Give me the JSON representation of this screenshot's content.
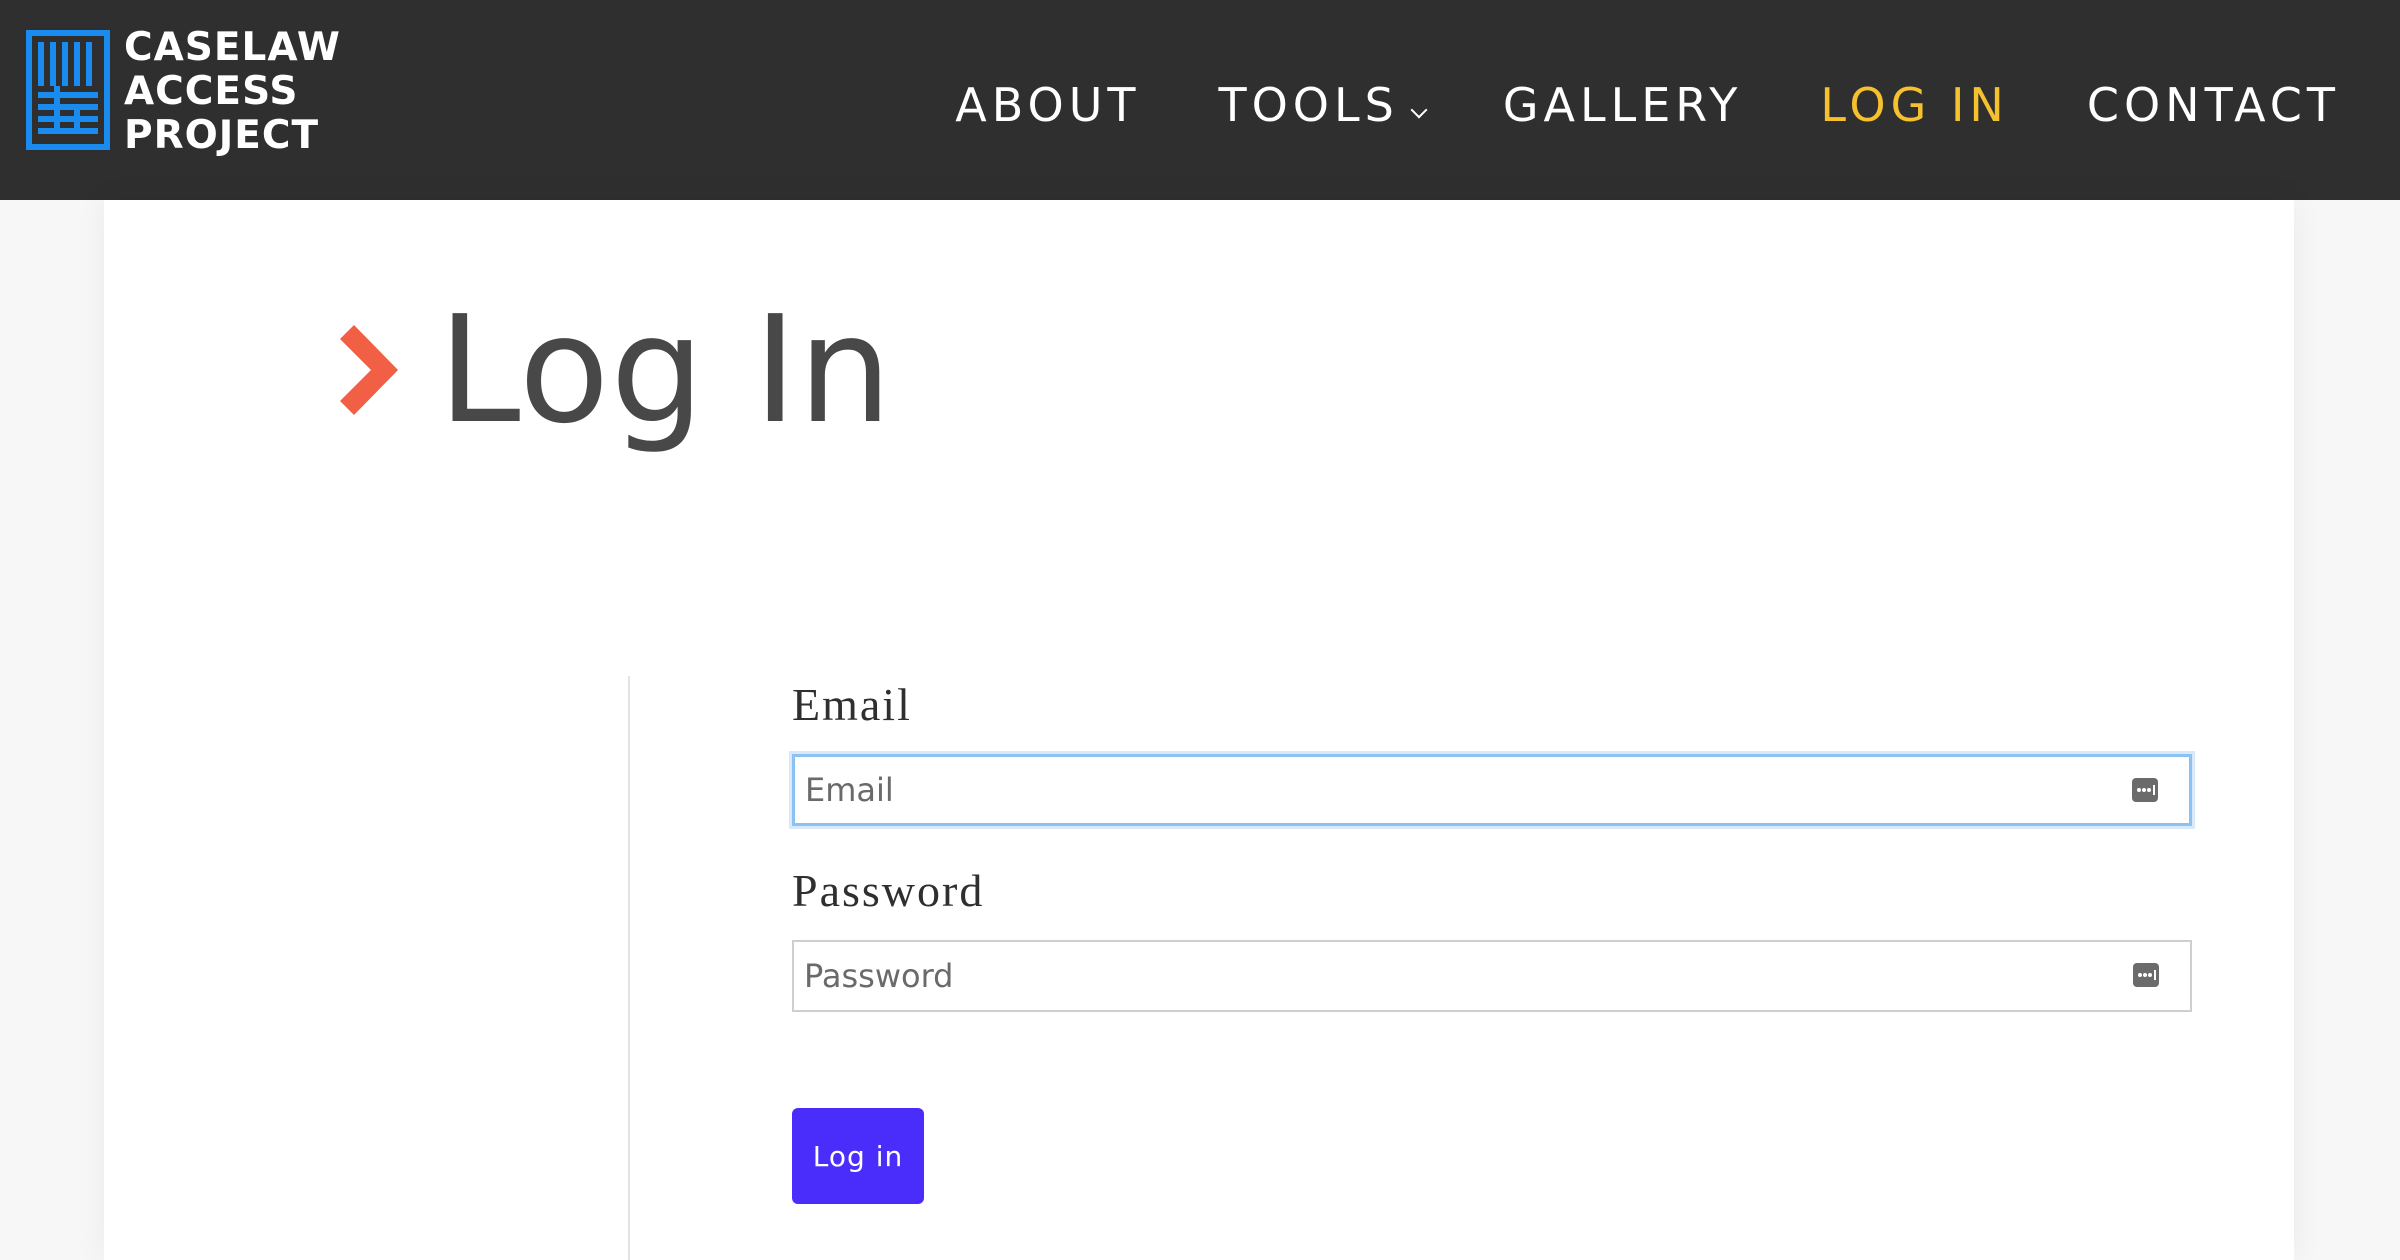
{
  "brand": {
    "name_lines": [
      "CASELAW",
      "ACCESS",
      "PROJECT"
    ],
    "logo_icon": "library-bars-icon",
    "color": "#1a8cf0"
  },
  "nav": {
    "items": [
      {
        "label": "ABOUT",
        "active": false
      },
      {
        "label": "TOOLS",
        "active": false,
        "has_dropdown": true
      },
      {
        "label": "GALLERY",
        "active": false
      },
      {
        "label": "LOG IN",
        "active": true
      },
      {
        "label": "CONTACT",
        "active": false
      }
    ],
    "active_color": "#f5c12e"
  },
  "page": {
    "title": "Log In",
    "title_icon": "chevron-diamond-icon",
    "accent_color": "#f15f45"
  },
  "form": {
    "email": {
      "label": "Email",
      "placeholder": "Email",
      "value": ""
    },
    "password": {
      "label": "Password",
      "placeholder": "Password",
      "value": ""
    },
    "submit_label": "Log in",
    "submit_color": "#4b2dfb"
  }
}
